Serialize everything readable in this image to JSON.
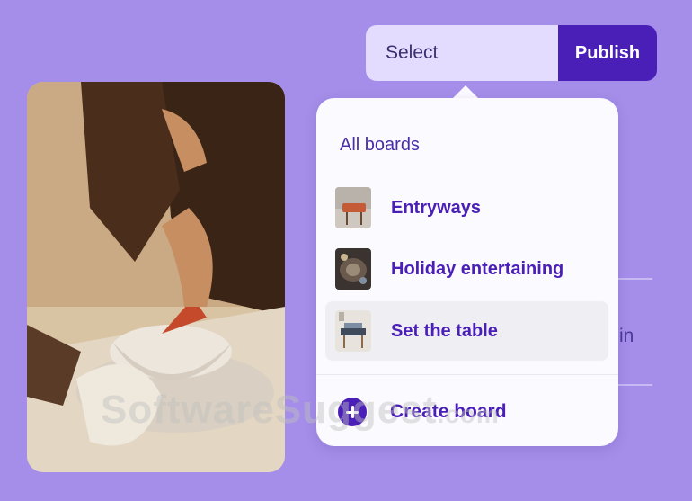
{
  "toolbar": {
    "select_label": "Select",
    "publish_label": "Publish"
  },
  "dropdown": {
    "heading": "All boards",
    "boards": [
      {
        "label": "Entryways"
      },
      {
        "label": "Holiday entertaining"
      },
      {
        "label": "Set the table"
      }
    ],
    "create_label": "Create board"
  },
  "background": {
    "partial_text": "in"
  },
  "watermark": {
    "main": "SoftwareSuggest",
    "suffix": ".com"
  },
  "colors": {
    "page_bg": "#a48ee9",
    "accent": "#4a1fb8",
    "select_bg": "#e4dcff"
  }
}
